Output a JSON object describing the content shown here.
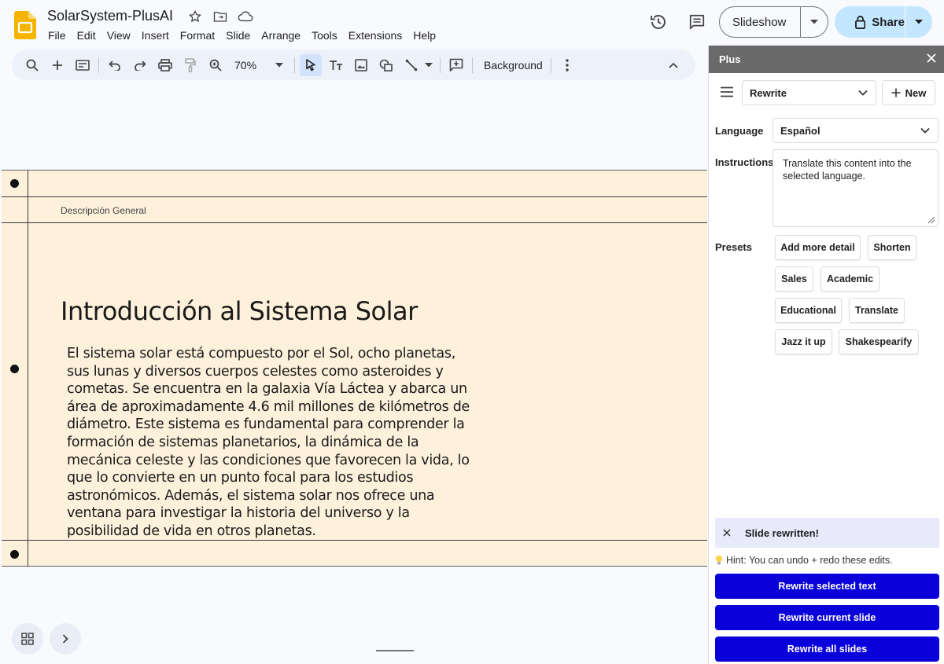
{
  "header": {
    "title": "SolarSystem-PlusAI",
    "menu": [
      "File",
      "Edit",
      "View",
      "Insert",
      "Format",
      "Slide",
      "Arrange",
      "Tools",
      "Extensions",
      "Help"
    ],
    "slideshow_label": "Slideshow",
    "share_label": "Share"
  },
  "toolbar": {
    "zoom": "70%",
    "background_label": "Background"
  },
  "slide": {
    "header": "Descripción General",
    "title": "Introducción al Sistema Solar",
    "body": "El sistema solar está compuesto por el Sol, ocho planetas, sus lunas y diversos cuerpos celestes como asteroides y cometas. Se encuentra en la galaxia Vía Láctea y abarca un área de aproximadamente 4.6 mil millones de kilómetros de diámetro. Este sistema es fundamental para comprender la formación de sistemas planetarios, la dinámica de la mecánica celeste y las condiciones que favorecen la vida, lo que lo convierte en un punto focal para los estudios astronómicos. Además, el sistema solar nos ofrece una ventana para investigar la historia del universo y la posibilidad de vida en otros planetas."
  },
  "panel": {
    "title": "Plus",
    "mode": "Rewrite",
    "new_label": "New",
    "language_label": "Language",
    "language_value": "Español",
    "instructions_label": "Instructions",
    "instructions_value": "Translate this content into the selected language.",
    "presets_label": "Presets",
    "presets": [
      "Add more detail",
      "Shorten",
      "Sales",
      "Academic",
      "Educational",
      "Translate",
      "Jazz it up",
      "Shakespearify"
    ],
    "toast": "Slide rewritten!",
    "hint": "Hint: You can undo + redo these edits.",
    "actions": [
      "Rewrite selected text",
      "Rewrite current slide",
      "Rewrite all slides"
    ]
  },
  "colors": {
    "accent": "#0a00d9",
    "share_bg": "#c2e7ff",
    "slide_bg": "#fdf1db",
    "panel_header": "#6a6a6a"
  }
}
